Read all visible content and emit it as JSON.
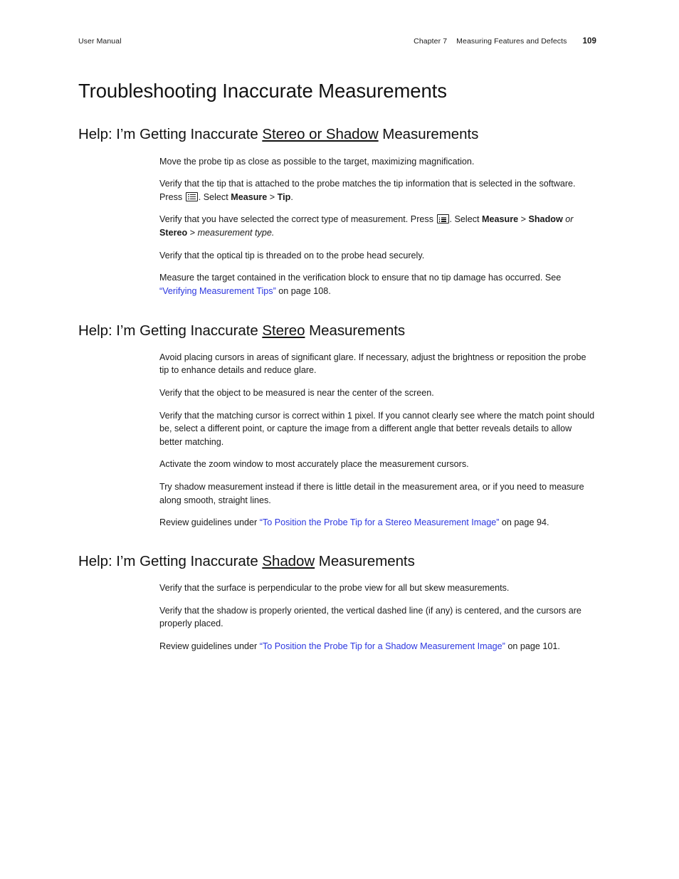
{
  "header": {
    "left_label": "User Manual",
    "chapter": "Chapter 7",
    "chapter_title": "Measuring Features and Defects",
    "page_number": "109"
  },
  "title": "Troubleshooting Inaccurate Measurements",
  "icons": {
    "menu_icon_name": "menu-list-icon"
  },
  "colors": {
    "link": "#2c37e0",
    "text": "#1a1a1a",
    "page_background": "#ffffff"
  },
  "sections": [
    {
      "heading": {
        "prefix": "Help: I’m Getting Inaccurate ",
        "underlined": "Stereo or Shadow",
        "suffix": " Measurements"
      },
      "paragraphs": {
        "p1": "Move the probe tip as close as possible to the target, maximizing magnification.",
        "p2_a": "Verify that the tip that is attached to the probe matches the tip information that is selected in the software. Press ",
        "p2_b": ". Select ",
        "p2_bold1": "Measure",
        "p2_sep": " > ",
        "p2_bold2": "Tip",
        "p2_end": ".",
        "p3_a": "Verify that you have selected the correct type of measurement. Press ",
        "p3_b": ". Select ",
        "p3_bold1": "Measure",
        "p3_sep1": " > ",
        "p3_bold2": "Shadow",
        "p3_italic1": " or ",
        "p3_bold3": "Stereo",
        "p3_sep2": " > ",
        "p3_italic2": "measurement type.",
        "p4": "Verify that the optical tip is threaded on to the probe head securely.",
        "p5_a": "Measure the target contained in the verification block to ensure that no tip damage has occurred. See ",
        "p5_link": "“Verifying Measurement Tips”",
        "p5_b": " on page 108."
      }
    },
    {
      "heading": {
        "prefix": "Help: I’m Getting Inaccurate ",
        "underlined": "Stereo",
        "suffix": " Measurements"
      },
      "paragraphs": {
        "p1": "Avoid placing cursors in areas of significant glare. If necessary, adjust the brightness or reposition the probe tip to enhance details and reduce glare.",
        "p2": "Verify that the object to be measured is near the center of the screen.",
        "p3": "Verify that the matching cursor is correct within 1 pixel. If you cannot clearly see where the match point should be, select a different point, or capture the image from a different angle that better reveals details to allow better matching.",
        "p4": "Activate the zoom window to most accurately place the measurement cursors.",
        "p5": "Try shadow measurement instead if there is little detail in the measurement area, or if you need to measure along smooth, straight lines.",
        "p6_a": "Review guidelines under ",
        "p6_link": "“To Position the Probe Tip for a Stereo Measurement Image”",
        "p6_b": " on page 94."
      }
    },
    {
      "heading": {
        "prefix": "Help: I’m Getting Inaccurate ",
        "underlined": "Shadow",
        "suffix": " Measurements"
      },
      "paragraphs": {
        "p1": "Verify that the surface is perpendicular to the probe view for all but skew measurements.",
        "p2": "Verify that the shadow is properly oriented, the vertical dashed line (if any) is centered, and the cursors are properly placed.",
        "p3_a": "Review guidelines under ",
        "p3_link": "“To Position the Probe Tip for a Shadow Measurement Image”",
        "p3_b": " on page 101."
      }
    }
  ]
}
